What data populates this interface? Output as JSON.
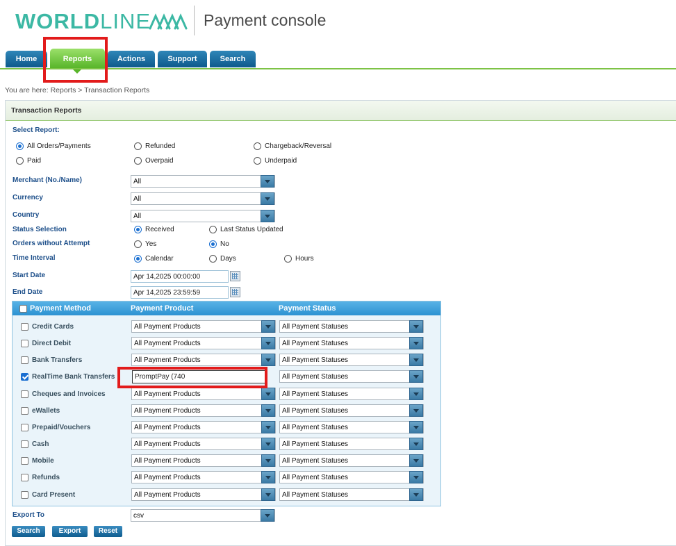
{
  "header": {
    "brand_bold": "WORLD",
    "brand_light": "LINE",
    "console_title": "Payment console"
  },
  "nav": {
    "tabs": [
      {
        "label": "Home"
      },
      {
        "label": "Reports"
      },
      {
        "label": "Actions"
      },
      {
        "label": "Support"
      },
      {
        "label": "Search"
      }
    ],
    "active": "Reports"
  },
  "breadcrumb": "You are here: Reports > Transaction Reports",
  "panel": {
    "title": "Transaction Reports",
    "select_report_label": "Select Report:",
    "report_options": [
      {
        "label": "All Orders/Payments",
        "selected": true
      },
      {
        "label": "Refunded",
        "selected": false
      },
      {
        "label": "Chargeback/Reversal",
        "selected": false
      },
      {
        "label": "Paid",
        "selected": false
      },
      {
        "label": "Overpaid",
        "selected": false
      },
      {
        "label": "Underpaid",
        "selected": false
      }
    ],
    "merchant": {
      "label": "Merchant (No./Name)",
      "value": "All"
    },
    "currency": {
      "label": "Currency",
      "value": "All"
    },
    "country": {
      "label": "Country",
      "value": "All"
    },
    "status_selection": {
      "label": "Status Selection",
      "options": [
        "Received",
        "Last Status Updated"
      ],
      "selected": "Received"
    },
    "orders_without_attempt": {
      "label": "Orders without Attempt",
      "options": [
        "Yes",
        "No"
      ],
      "selected": "No"
    },
    "time_interval": {
      "label": "Time Interval",
      "options": [
        "Calendar",
        "Days",
        "Hours"
      ],
      "selected": "Calendar"
    },
    "start_date": {
      "label": "Start Date",
      "value": "Apr 14,2025 00:00:00"
    },
    "end_date": {
      "label": "End Date",
      "value": "Apr 14,2025 23:59:59"
    },
    "payment_table": {
      "headers": {
        "method": "Payment Method",
        "product": "Payment Product",
        "status": "Payment Status"
      },
      "rows": [
        {
          "method": "Credit Cards",
          "checked": false,
          "product": "All Payment Products",
          "status": "All Payment Statuses"
        },
        {
          "method": "Direct Debit",
          "checked": false,
          "product": "All Payment Products",
          "status": "All Payment Statuses"
        },
        {
          "method": "Bank Transfers",
          "checked": false,
          "product": "All Payment Products",
          "status": "All Payment Statuses"
        },
        {
          "method": "RealTime Bank Transfers",
          "checked": true,
          "product": "PromptPay (740",
          "status": "All Payment Statuses"
        },
        {
          "method": "Cheques and Invoices",
          "checked": false,
          "product": "All Payment Products",
          "status": "All Payment Statuses"
        },
        {
          "method": "eWallets",
          "checked": false,
          "product": "All Payment Products",
          "status": "All Payment Statuses"
        },
        {
          "method": "Prepaid/Vouchers",
          "checked": false,
          "product": "All Payment Products",
          "status": "All Payment Statuses"
        },
        {
          "method": "Cash",
          "checked": false,
          "product": "All Payment Products",
          "status": "All Payment Statuses"
        },
        {
          "method": "Mobile",
          "checked": false,
          "product": "All Payment Products",
          "status": "All Payment Statuses"
        },
        {
          "method": "Refunds",
          "checked": false,
          "product": "All Payment Products",
          "status": "All Payment Statuses"
        },
        {
          "method": "Card Present",
          "checked": false,
          "product": "All Payment Products",
          "status": "All Payment Statuses"
        }
      ]
    },
    "export_to": {
      "label": "Export To",
      "value": "csv"
    },
    "buttons": {
      "search": "Search",
      "export": "Export",
      "reset": "Reset"
    }
  },
  "colors": {
    "brand_teal": "#3cb8a4",
    "nav_blue": "#0e5a8c",
    "nav_active_green": "#58b52a",
    "label_blue": "#1d4f8a",
    "highlight_red": "#e21b1b"
  }
}
